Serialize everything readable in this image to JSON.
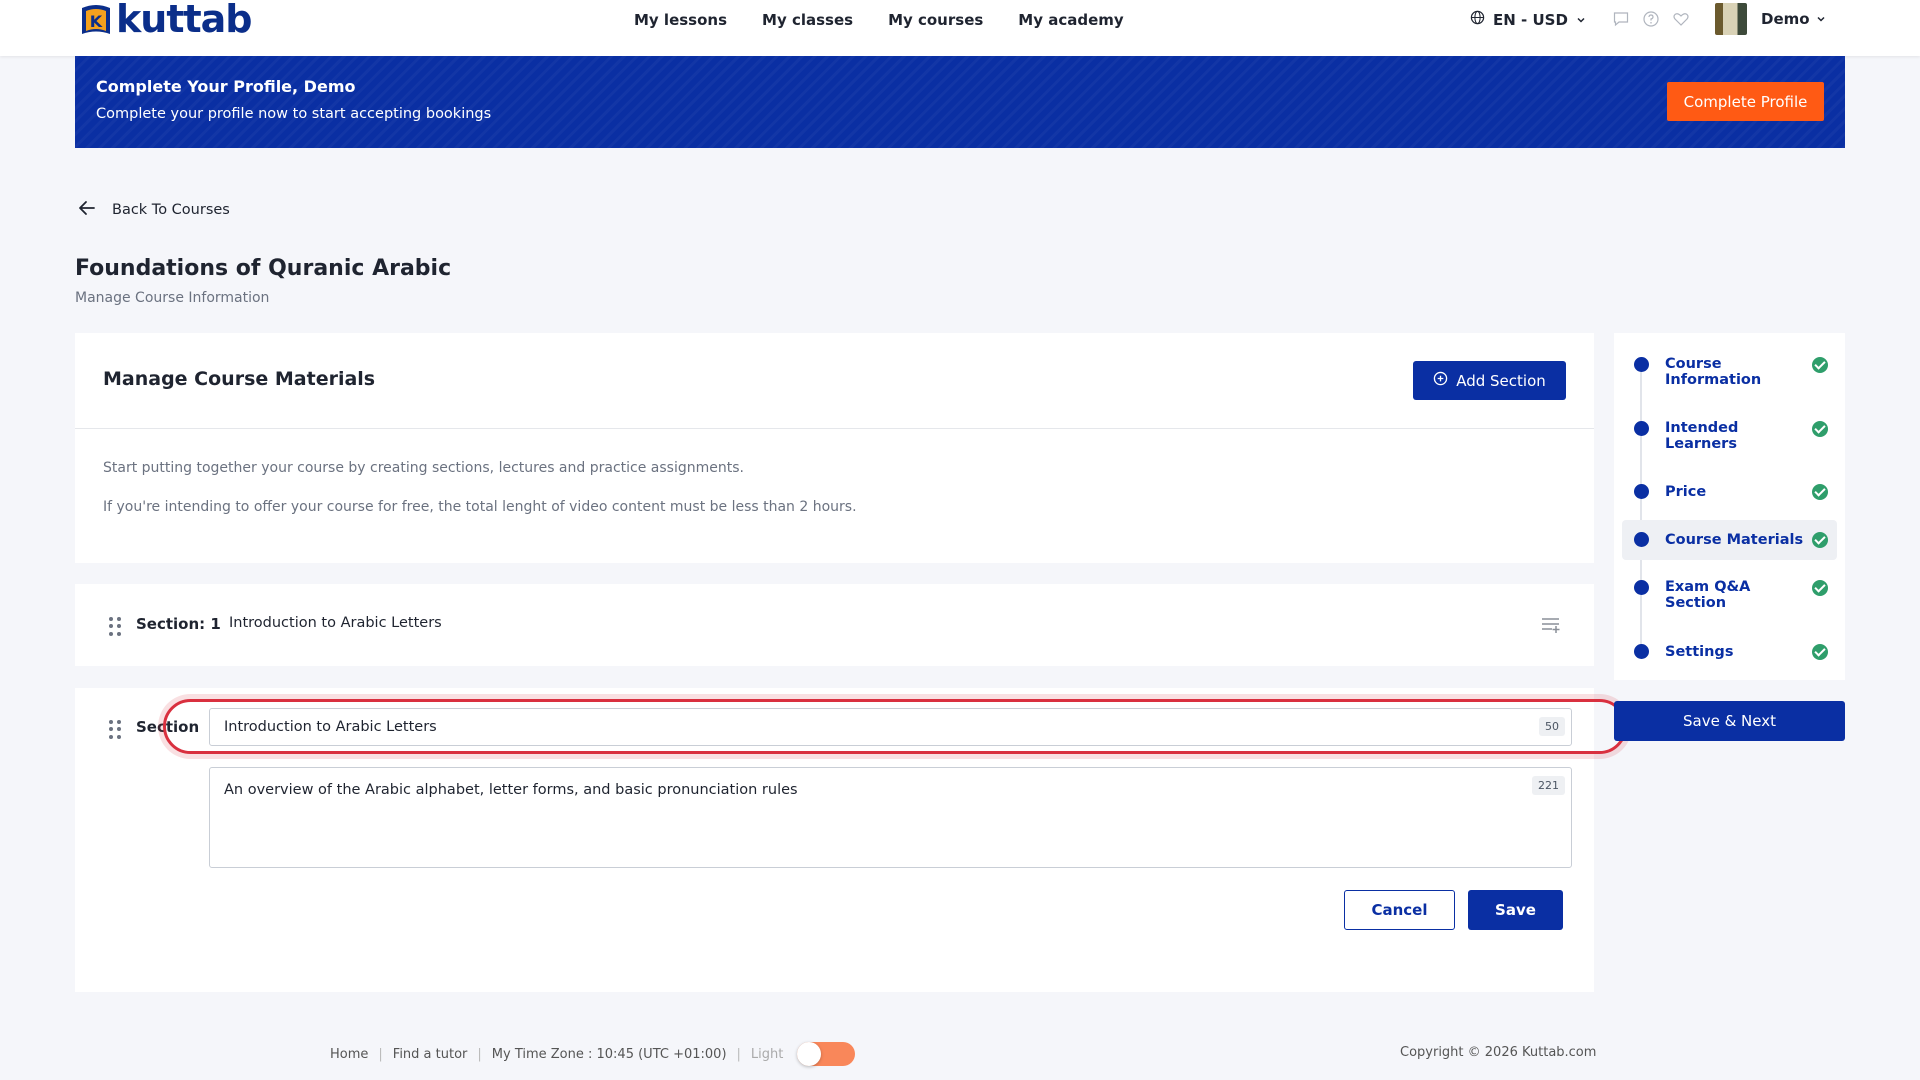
{
  "header": {
    "logo_text": "kuttab",
    "logo_letter": "K",
    "nav": [
      "My lessons",
      "My classes",
      "My courses",
      "My academy"
    ],
    "language": "EN - USD",
    "user_name": "Demo"
  },
  "banner": {
    "title": "Complete Your Profile, Demo",
    "subtitle": "Complete your profile now to start accepting bookings",
    "button": "Complete Profile"
  },
  "back_link": "Back To Courses",
  "page": {
    "title": "Foundations of Quranic Arabic",
    "subtitle": "Manage Course Information"
  },
  "materials": {
    "heading": "Manage Course Materials",
    "add_section": "Add Section",
    "info_1": "Start putting together your course by creating sections, lectures and practice assignments.",
    "info_2": "If you're intending to offer your course for free, the total lenght of video content must be less than 2 hours."
  },
  "section_1": {
    "label": "Section: 1",
    "title": "Introduction to Arabic Letters"
  },
  "edit_section": {
    "label": "Section",
    "title_value": "Introduction to Arabic Letters",
    "title_counter": "50",
    "description_value": "An overview of the Arabic alphabet, letter forms, and basic pronunciation rules",
    "description_counter": "221",
    "cancel": "Cancel",
    "save": "Save"
  },
  "stepper": {
    "steps": [
      {
        "label": "Course Information",
        "complete": true
      },
      {
        "label": "Intended Learners",
        "complete": true
      },
      {
        "label": "Price",
        "complete": true
      },
      {
        "label": "Course Materials",
        "complete": true,
        "active": true
      },
      {
        "label": "Exam Q&A Section",
        "complete": true
      },
      {
        "label": "Settings",
        "complete": true
      }
    ],
    "save_next": "Save & Next"
  },
  "footer": {
    "home": "Home",
    "find_tutor": "Find a tutor",
    "timezone": "My Time Zone : 10:45 (UTC +01:00)",
    "theme_label": "Light",
    "copyright": "Copyright © 2026 Kuttab.com"
  },
  "colors": {
    "primary": "#0a2fa3",
    "accent": "#ff5a14",
    "success": "#2f9e6b",
    "focus": "#d9303f"
  }
}
